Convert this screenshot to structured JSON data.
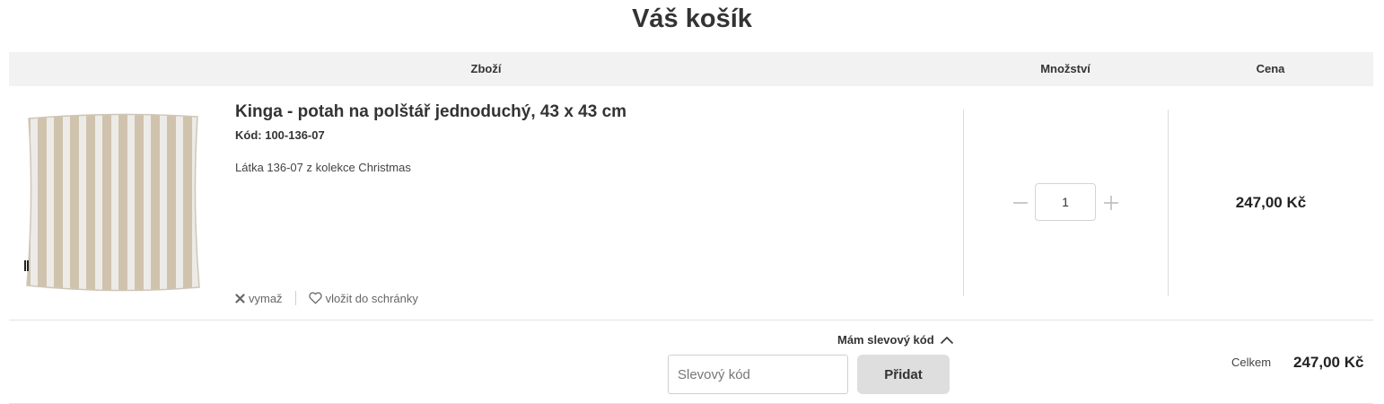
{
  "page": {
    "title": "Váš košík"
  },
  "table_header": {
    "goods": "Zboží",
    "quantity": "Množství",
    "price": "Cena"
  },
  "cart_item": {
    "title": "Kinga - potah na polštář jednoduchý, 43 x 43 cm",
    "code": "Kód: 100-136-07",
    "description": "Látka 136-07 z kolekce Christmas",
    "image_icon": "striped-cushion-image",
    "quantity": "1",
    "price": "247,00 Kč",
    "actions": {
      "remove_label": "vymaž",
      "remove_icon": "close-icon",
      "wishlist_label": "vložit do schránky",
      "wishlist_icon": "heart-icon"
    }
  },
  "discount": {
    "toggle_label": "Mám slevový kód",
    "toggle_icon": "chevron-up-icon",
    "input_placeholder": "Slevový kód",
    "input_value": "",
    "add_button_label": "Přidat"
  },
  "summary": {
    "total_label": "Celkem",
    "total_value": "247,00 Kč"
  },
  "colors": {
    "header_background": "#f2f2f2",
    "button_background": "#dedede",
    "text": "#333333",
    "stripe_beige": "#d9cbb6",
    "stripe_white": "#f7f5f1"
  }
}
